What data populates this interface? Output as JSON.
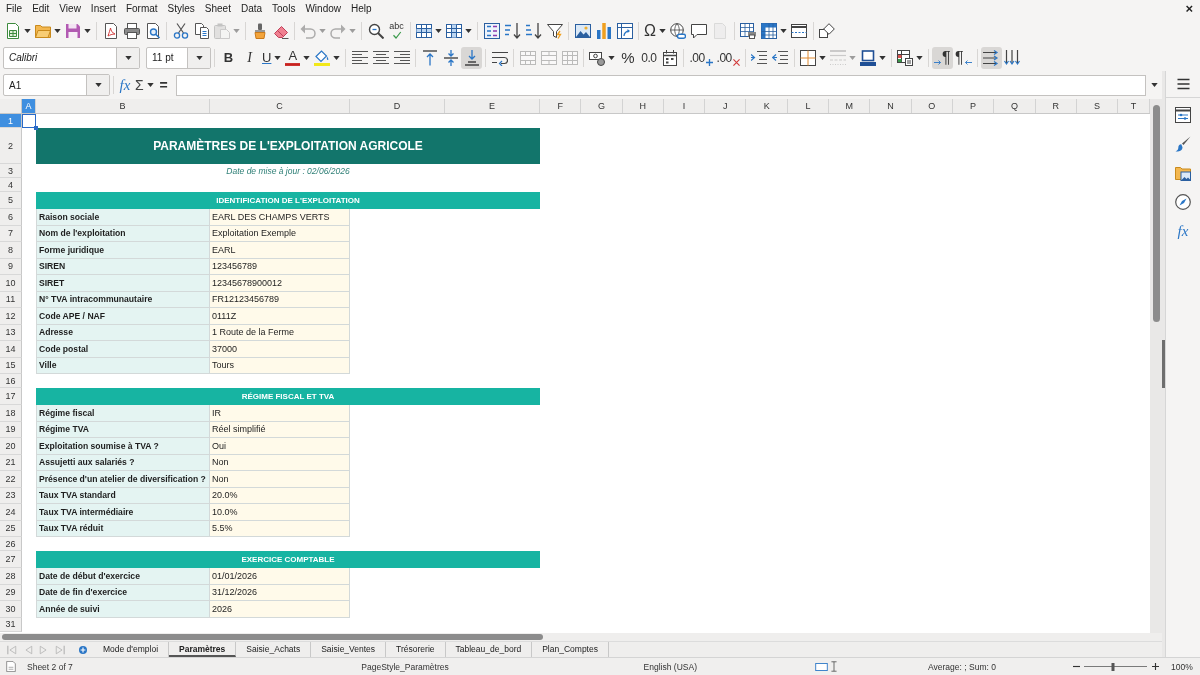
{
  "menu_bar": {
    "items": [
      "File",
      "Edit",
      "View",
      "Insert",
      "Format",
      "Styles",
      "Sheet",
      "Data",
      "Tools",
      "Window",
      "Help"
    ],
    "close": "×"
  },
  "standard_toolbar": {
    "groups": [
      {
        "buttons": [
          {
            "kind": "new_spreadsheet",
            "dropdown": true,
            "disabled": false
          },
          {
            "kind": "open",
            "dropdown": true,
            "disabled": false
          },
          {
            "kind": "save",
            "dropdown": true,
            "disabled": false
          }
        ]
      },
      {
        "buttons": [
          {
            "kind": "export_pdf",
            "dropdown": false,
            "disabled": false
          },
          {
            "kind": "print",
            "dropdown": false,
            "disabled": false
          },
          {
            "kind": "print_preview",
            "dropdown": false,
            "disabled": false
          }
        ]
      },
      {
        "buttons": [
          {
            "kind": "cut",
            "dropdown": false,
            "disabled": false
          },
          {
            "kind": "copy",
            "dropdown": false,
            "disabled": false
          },
          {
            "kind": "paste",
            "dropdown": true,
            "disabled": true
          }
        ]
      },
      {
        "buttons": [
          {
            "kind": "clone_formatting",
            "dropdown": false,
            "disabled": false
          },
          {
            "kind": "clear_formatting",
            "dropdown": false,
            "disabled": false
          }
        ]
      },
      {
        "buttons": [
          {
            "kind": "undo",
            "dropdown": true,
            "disabled": true
          },
          {
            "kind": "redo",
            "dropdown": true,
            "disabled": true
          }
        ]
      },
      {
        "buttons": [
          {
            "kind": "find_replace",
            "dropdown": false,
            "disabled": false
          },
          {
            "kind": "spelling",
            "label": "abc",
            "dropdown": false,
            "disabled": false
          }
        ]
      },
      {
        "buttons": [
          {
            "kind": "rows",
            "dropdown": true,
            "disabled": false
          },
          {
            "kind": "columns",
            "dropdown": true,
            "disabled": false
          }
        ]
      },
      {
        "buttons": [
          {
            "kind": "sort",
            "dropdown": false,
            "disabled": false
          },
          {
            "kind": "sort_ascending",
            "dropdown": false,
            "disabled": false
          },
          {
            "kind": "sort_descending",
            "dropdown": false,
            "disabled": false
          },
          {
            "kind": "autofilter",
            "dropdown": false,
            "disabled": false
          }
        ]
      },
      {
        "buttons": [
          {
            "kind": "image",
            "dropdown": false,
            "disabled": false
          },
          {
            "kind": "chart",
            "dropdown": false,
            "disabled": false
          },
          {
            "kind": "pivot_table",
            "dropdown": false,
            "disabled": false
          }
        ]
      },
      {
        "buttons": [
          {
            "kind": "special_character",
            "label": "Ω",
            "dropdown": true,
            "disabled": false
          },
          {
            "kind": "hyperlink",
            "dropdown": false,
            "disabled": false
          },
          {
            "kind": "comment",
            "dropdown": false,
            "disabled": false
          },
          {
            "kind": "header_footer",
            "dropdown": false,
            "disabled": true
          }
        ]
      },
      {
        "buttons": [
          {
            "kind": "print_area",
            "dropdown": false,
            "disabled": false
          },
          {
            "kind": "freeze",
            "dropdown": true,
            "disabled": false
          },
          {
            "kind": "split_window",
            "dropdown": false,
            "disabled": false
          }
        ]
      },
      {
        "buttons": [
          {
            "kind": "draw_functions",
            "dropdown": false,
            "disabled": false
          }
        ]
      }
    ]
  },
  "formatting_toolbar": {
    "font_name": "Calibri",
    "font_size": "11 pt",
    "groups": [
      {
        "buttons": [
          {
            "kind": "bold",
            "label": "B",
            "dropdown": false,
            "disabled": false,
            "pressed": false
          },
          {
            "kind": "italic",
            "label": "I",
            "dropdown": false,
            "disabled": false,
            "pressed": false
          },
          {
            "kind": "underline",
            "label": "U",
            "dropdown": true,
            "disabled": false,
            "pressed": false
          },
          {
            "kind": "font_color",
            "label": "A",
            "dropdown": true,
            "disabled": false,
            "pressed": false
          },
          {
            "kind": "highlight",
            "dropdown": true,
            "disabled": false,
            "pressed": false
          }
        ]
      },
      {
        "buttons": [
          {
            "kind": "align_left",
            "dropdown": false,
            "disabled": false,
            "pressed": false
          },
          {
            "kind": "align_center",
            "dropdown": false,
            "disabled": false,
            "pressed": false
          },
          {
            "kind": "align_right",
            "dropdown": false,
            "disabled": false,
            "pressed": false
          }
        ]
      },
      {
        "buttons": [
          {
            "kind": "align_top",
            "dropdown": false,
            "disabled": false,
            "pressed": false
          },
          {
            "kind": "center_vertically",
            "dropdown": false,
            "disabled": false,
            "pressed": false
          },
          {
            "kind": "align_bottom",
            "dropdown": false,
            "disabled": false,
            "pressed": true
          }
        ]
      },
      {
        "buttons": [
          {
            "kind": "wrap_text",
            "dropdown": false,
            "disabled": false,
            "pressed": false
          }
        ]
      },
      {
        "buttons": [
          {
            "kind": "merge_center",
            "dropdown": false,
            "disabled": true,
            "pressed": false
          },
          {
            "kind": "merge",
            "dropdown": false,
            "disabled": true,
            "pressed": false
          },
          {
            "kind": "unmerge",
            "dropdown": false,
            "disabled": true,
            "pressed": false
          }
        ]
      },
      {
        "buttons": [
          {
            "kind": "currency",
            "dropdown": true,
            "disabled": false,
            "pressed": false
          },
          {
            "kind": "percent",
            "label": "%",
            "dropdown": false,
            "disabled": false,
            "pressed": false
          },
          {
            "kind": "number",
            "label": "0.0",
            "dropdown": false,
            "disabled": false,
            "pressed": false
          },
          {
            "kind": "date",
            "dropdown": false,
            "disabled": false,
            "pressed": false
          }
        ]
      },
      {
        "buttons": [
          {
            "kind": "add_decimal",
            "label": ".00",
            "dropdown": false,
            "disabled": false,
            "pressed": false
          },
          {
            "kind": "delete_decimal",
            "label": ".00",
            "dropdown": false,
            "disabled": false,
            "pressed": false
          }
        ]
      },
      {
        "buttons": [
          {
            "kind": "increase_indent",
            "dropdown": false,
            "disabled": false,
            "pressed": false
          },
          {
            "kind": "decrease_indent",
            "dropdown": false,
            "disabled": false,
            "pressed": false
          }
        ]
      },
      {
        "buttons": [
          {
            "kind": "borders",
            "dropdown": true,
            "disabled": false,
            "pressed": false
          },
          {
            "kind": "border_style",
            "dropdown": true,
            "disabled": true,
            "pressed": false
          },
          {
            "kind": "border_color",
            "dropdown": true,
            "disabled": false,
            "pressed": false
          }
        ]
      },
      {
        "buttons": [
          {
            "kind": "conditional",
            "dropdown": true,
            "disabled": false,
            "pressed": false
          }
        ]
      },
      {
        "buttons": [
          {
            "kind": "paragraph_ltr",
            "label": "¶",
            "dropdown": false,
            "disabled": false,
            "pressed": true
          },
          {
            "kind": "paragraph_rtl",
            "label": "¶",
            "dropdown": false,
            "disabled": false,
            "pressed": false
          }
        ]
      },
      {
        "buttons": [
          {
            "kind": "text_ltr",
            "dropdown": false,
            "disabled": false,
            "pressed": true
          },
          {
            "kind": "text_ttb",
            "dropdown": false,
            "disabled": false,
            "pressed": false
          }
        ]
      }
    ]
  },
  "formula_bar": {
    "name_box": "A1",
    "buttons": [
      {
        "kind": "function_wizard",
        "label": "fx",
        "dropdown": false
      },
      {
        "kind": "sum",
        "label": "Σ",
        "dropdown": true
      },
      {
        "kind": "formula",
        "label": "=",
        "dropdown": false
      }
    ]
  },
  "sidebar": {
    "items": [
      {
        "kind": "menu"
      },
      {
        "kind": "properties"
      },
      {
        "kind": "styles"
      },
      {
        "kind": "gallery"
      },
      {
        "kind": "navigator"
      },
      {
        "kind": "functions",
        "label": "fx"
      }
    ]
  },
  "sheet": {
    "columns": [
      {
        "label": "A",
        "selected": true
      },
      {
        "label": "B",
        "selected": false
      },
      {
        "label": "C",
        "selected": false
      },
      {
        "label": "D",
        "selected": false
      },
      {
        "label": "E",
        "selected": false
      },
      {
        "label": "F",
        "selected": false
      },
      {
        "label": "G",
        "selected": false
      },
      {
        "label": "H",
        "selected": false
      },
      {
        "label": "I",
        "selected": false
      },
      {
        "label": "J",
        "selected": false
      },
      {
        "label": "K",
        "selected": false
      },
      {
        "label": "L",
        "selected": false
      },
      {
        "label": "M",
        "selected": false
      },
      {
        "label": "N",
        "selected": false
      },
      {
        "label": "O",
        "selected": false
      },
      {
        "label": "P",
        "selected": false
      },
      {
        "label": "Q",
        "selected": false
      },
      {
        "label": "R",
        "selected": false
      },
      {
        "label": "S",
        "selected": false
      },
      {
        "label": "T",
        "selected": false
      }
    ],
    "rows": [
      {
        "label": "1",
        "selected": true
      },
      {
        "label": "2",
        "selected": false
      },
      {
        "label": "3",
        "selected": false
      },
      {
        "label": "4",
        "selected": false
      },
      {
        "label": "5",
        "selected": false
      },
      {
        "label": "6",
        "selected": false
      },
      {
        "label": "7",
        "selected": false
      },
      {
        "label": "8",
        "selected": false
      },
      {
        "label": "9",
        "selected": false
      },
      {
        "label": "10",
        "selected": false
      },
      {
        "label": "11",
        "selected": false
      },
      {
        "label": "12",
        "selected": false
      },
      {
        "label": "13",
        "selected": false
      },
      {
        "label": "14",
        "selected": false
      },
      {
        "label": "15",
        "selected": false
      },
      {
        "label": "16",
        "selected": false
      },
      {
        "label": "17",
        "selected": false
      },
      {
        "label": "18",
        "selected": false
      },
      {
        "label": "19",
        "selected": false
      },
      {
        "label": "20",
        "selected": false
      },
      {
        "label": "21",
        "selected": false
      },
      {
        "label": "22",
        "selected": false
      },
      {
        "label": "23",
        "selected": false
      },
      {
        "label": "24",
        "selected": false
      },
      {
        "label": "25",
        "selected": false
      },
      {
        "label": "26",
        "selected": false
      },
      {
        "label": "27",
        "selected": false
      },
      {
        "label": "28",
        "selected": false
      },
      {
        "label": "29",
        "selected": false
      },
      {
        "label": "30",
        "selected": false
      },
      {
        "label": "31",
        "selected": false
      }
    ],
    "title": "PARAMÈTRES DE L'EXPLOITATION AGRICOLE",
    "subtitle": "Date de mise à jour : 02/06/2026",
    "sections": [
      {
        "title": "IDENTIFICATION DE L'EXPLOITATION",
        "fields": [
          {
            "label": "Raison sociale",
            "value": "EARL DES CHAMPS VERTS"
          },
          {
            "label": "Nom de l'exploitation",
            "value": "Exploitation Exemple"
          },
          {
            "label": "Forme juridique",
            "value": "EARL"
          },
          {
            "label": "SIREN",
            "value": "123456789"
          },
          {
            "label": "SIRET",
            "value": "12345678900012"
          },
          {
            "label": "N° TVA intracommunautaire",
            "value": "FR12123456789"
          },
          {
            "label": "Code APE / NAF",
            "value": "0111Z"
          },
          {
            "label": "Adresse",
            "value": "1 Route de la Ferme"
          },
          {
            "label": "Code postal",
            "value": "37000"
          },
          {
            "label": "Ville",
            "value": "Tours"
          }
        ]
      },
      {
        "title": "RÉGIME FISCAL ET TVA",
        "fields": [
          {
            "label": "Régime fiscal",
            "value": "IR"
          },
          {
            "label": "Régime TVA",
            "value": "Réel simplifié"
          },
          {
            "label": "Exploitation soumise à TVA ?",
            "value": "Oui"
          },
          {
            "label": "Assujetti aux salariés ?",
            "value": "Non"
          },
          {
            "label": "Présence d'un atelier de diversification ?",
            "value": "Non"
          },
          {
            "label": "Taux TVA standard",
            "value": "20.0%"
          },
          {
            "label": "Taux TVA intermédiaire",
            "value": "10.0%"
          },
          {
            "label": "Taux TVA réduit",
            "value": "5.5%"
          }
        ]
      },
      {
        "title": "EXERCICE COMPTABLE",
        "fields": [
          {
            "label": "Date de début d'exercice",
            "value": "01/01/2026"
          },
          {
            "label": "Date de fin d'exercice",
            "value": "31/12/2026"
          },
          {
            "label": "Année de suivi",
            "value": "2026"
          }
        ]
      }
    ]
  },
  "sheet_tabs": [
    {
      "label": "Mode d'emploi",
      "selected": false
    },
    {
      "label": "Paramètres",
      "selected": true
    },
    {
      "label": "Saisie_Achats",
      "selected": false
    },
    {
      "label": "Saisie_Ventes",
      "selected": false
    },
    {
      "label": "Trésorerie",
      "selected": false
    },
    {
      "label": "Tableau_de_bord",
      "selected": false
    },
    {
      "label": "Plan_Comptes",
      "selected": false
    }
  ],
  "status_bar": {
    "sheet": "Sheet 2 of 7",
    "page_style": "PageStyle_Paramètres",
    "language": "English (USA)",
    "statistics": "Average: ; Sum: 0",
    "zoom": {
      "level": 0.46,
      "value": "100%"
    }
  }
}
